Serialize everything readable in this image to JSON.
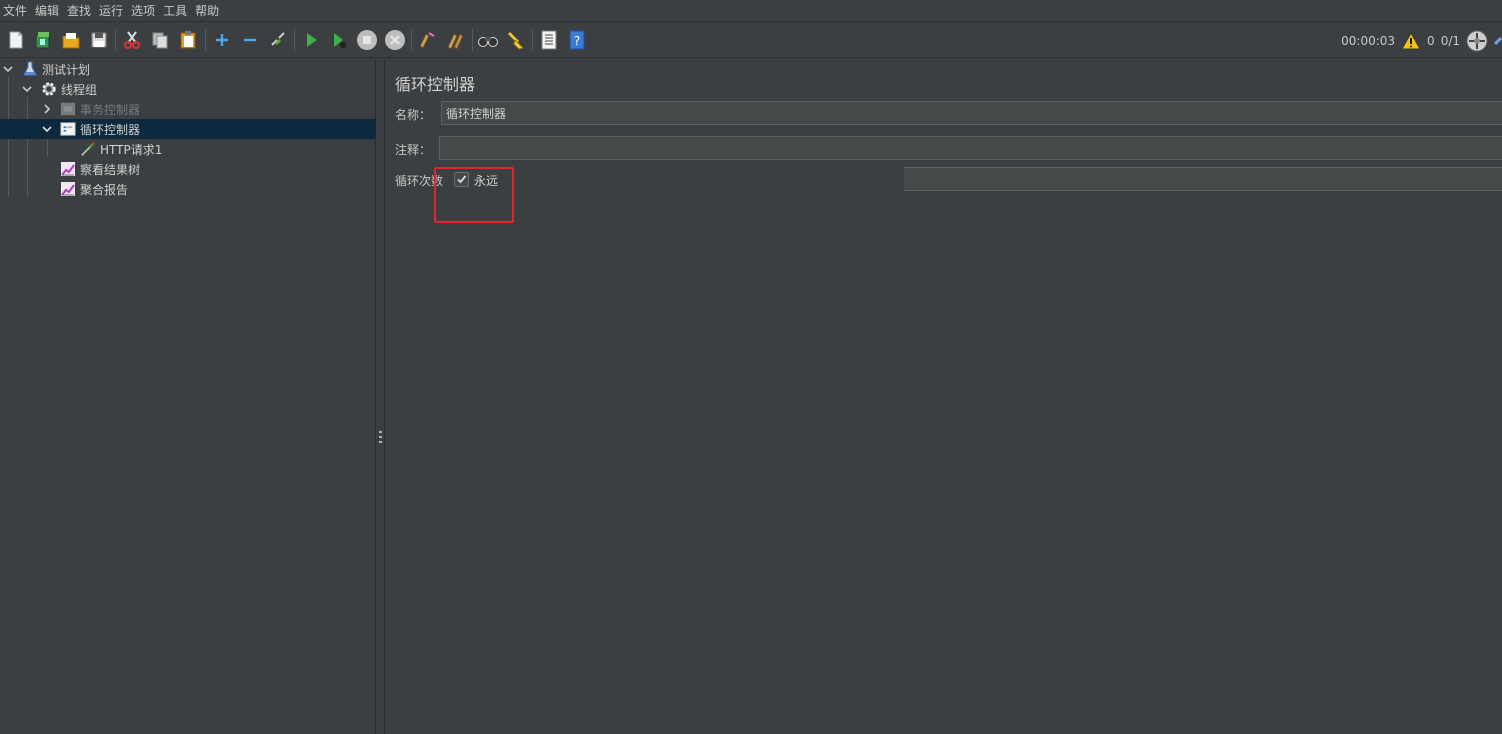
{
  "menubar": {
    "items": [
      "文件",
      "编辑",
      "查找",
      "运行",
      "选项",
      "工具",
      "帮助"
    ]
  },
  "toolbar": {
    "buttons": [
      {
        "name": "new-icon"
      },
      {
        "name": "templates-icon"
      },
      {
        "name": "open-icon"
      },
      {
        "name": "save-icon"
      },
      {
        "name": "cut-icon"
      },
      {
        "name": "copy-icon"
      },
      {
        "name": "paste-icon"
      },
      {
        "name": "expand-icon"
      },
      {
        "name": "collapse-icon"
      },
      {
        "name": "toggle-icon"
      },
      {
        "name": "start-icon"
      },
      {
        "name": "start-no-pause-icon"
      },
      {
        "name": "stop-icon"
      },
      {
        "name": "shutdown-icon"
      },
      {
        "name": "clear-icon"
      },
      {
        "name": "clear-all-icon"
      },
      {
        "name": "search-icon"
      },
      {
        "name": "reset-search-icon"
      },
      {
        "name": "function-helper-icon"
      },
      {
        "name": "help-icon"
      }
    ],
    "elapsed_time": "00:00:03",
    "warning_count": "0",
    "thread_ratio": "0/1"
  },
  "tree": {
    "nodes": [
      {
        "label": "测试计划",
        "icon": "test-plan-icon",
        "disabled": false
      },
      {
        "label": "线程组",
        "icon": "gear-icon",
        "disabled": false
      },
      {
        "label": "事务控制器",
        "icon": "transaction-controller-icon",
        "disabled": true
      },
      {
        "label": "循环控制器",
        "icon": "loop-controller-icon",
        "disabled": false
      },
      {
        "label": "HTTP请求1",
        "icon": "http-sampler-icon",
        "disabled": false
      },
      {
        "label": "察看结果树",
        "icon": "listener-icon",
        "disabled": false
      },
      {
        "label": "聚合报告",
        "icon": "listener-icon",
        "disabled": false
      }
    ]
  },
  "panel": {
    "title": "循环控制器",
    "name_label": "名称：",
    "name_value": "循环控制器",
    "comment_label": "注释：",
    "comment_value": "",
    "loop_label": "循环次数",
    "forever_label": "永远",
    "forever_checked": true
  },
  "colors": {
    "background": "#3c3f41",
    "selection": "#0d293e",
    "highlight": "#e0262b",
    "field": "#45494a"
  }
}
